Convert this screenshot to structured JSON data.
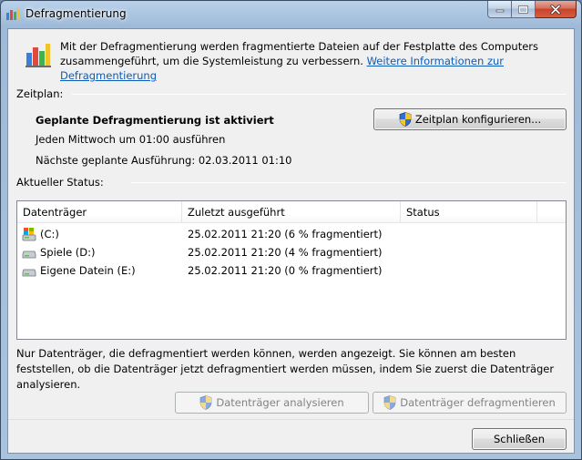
{
  "window": {
    "title": "Defragmentierung",
    "app_icon": "defrag-icon"
  },
  "intro": {
    "text": "Mit der Defragmentierung werden fragmentierte Dateien auf der Festplatte des Computers zusammengeführt, um die Systemleistung zu verbessern.",
    "link": "Weitere Informationen zur Defragmentierung"
  },
  "schedule": {
    "section_label": "Zeitplan:",
    "title": "Geplante Defragmentierung ist aktiviert",
    "line1": "Jeden Mittwoch um 01:00 ausführen",
    "line2": "Nächste geplante Ausführung: 02.03.2011 01:10",
    "configure_button": "Zeitplan konfigurieren..."
  },
  "status": {
    "section_label": "Aktueller Status:",
    "columns": [
      "Datenträger",
      "Zuletzt ausgeführt",
      "Status"
    ],
    "drives": [
      {
        "name": "(C:)",
        "last_run": "25.02.2011 21:20 (6 % fragmentiert)",
        "status": "",
        "icon": "system-drive-icon"
      },
      {
        "name": "Spiele (D:)",
        "last_run": "25.02.2011 21:20 (4 % fragmentiert)",
        "status": "",
        "icon": "hard-drive-icon"
      },
      {
        "name": "Eigene Datein (E:)",
        "last_run": "25.02.2011 21:20 (0 % fragmentiert)",
        "status": "",
        "icon": "hard-drive-icon"
      }
    ]
  },
  "info_text": "Nur Datenträger, die defragmentiert werden können, werden angezeigt. Sie können am besten feststellen, ob die Datenträger jetzt defragmentiert werden müssen, indem Sie zuerst die Datenträger analysieren.",
  "actions": {
    "analyze_button": "Datenträger analysieren",
    "defrag_button": "Datenträger defragmentieren",
    "close_button": "Schließen"
  }
}
